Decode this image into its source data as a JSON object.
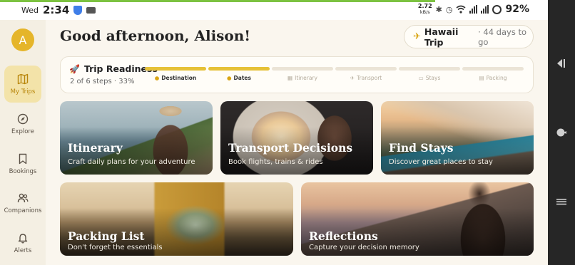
{
  "status_bar": {
    "day": "Wed",
    "time": "2:34",
    "net_speed_value": "2.72",
    "net_speed_unit": "kB/s",
    "battery": "92%"
  },
  "sidebar": {
    "avatar_initial": "A",
    "items": [
      {
        "label": "My Trips",
        "icon": "map-icon",
        "active": true
      },
      {
        "label": "Explore",
        "icon": "compass-icon",
        "active": false
      },
      {
        "label": "Bookings",
        "icon": "bookmark-icon",
        "active": false
      },
      {
        "label": "Companions",
        "icon": "users-icon",
        "active": false
      },
      {
        "label": "Alerts",
        "icon": "bell-icon",
        "active": false
      }
    ]
  },
  "header": {
    "greeting": "Good afternoon, Alison!",
    "trip_name": "Hawaii Trip",
    "trip_countdown": "· 44 days to go"
  },
  "readiness": {
    "title": "Trip Readiness",
    "summary": "2 of 6 steps · 33%",
    "progress_fraction": 0.33,
    "steps": [
      {
        "label": "Destination",
        "done": true
      },
      {
        "label": "Dates",
        "done": true
      },
      {
        "label": "Itinerary",
        "done": false
      },
      {
        "label": "Transport",
        "done": false
      },
      {
        "label": "Stays",
        "done": false
      },
      {
        "label": "Packing",
        "done": false
      }
    ]
  },
  "tiles": [
    {
      "title": "Itinerary",
      "subtitle": "Craft daily plans for your adventure"
    },
    {
      "title": "Transport Decisions",
      "subtitle": "Book flights, trains & rides"
    },
    {
      "title": "Find Stays",
      "subtitle": "Discover great places to stay"
    },
    {
      "title": "Packing List",
      "subtitle": "Don't forget the essentials"
    },
    {
      "title": "Reflections",
      "subtitle": "Capture your decision memory"
    }
  ],
  "colors": {
    "accent": "#e5b52a",
    "background": "#faf6ee",
    "sidebar_active": "#f3e3a9",
    "progress_done": "#e6c137"
  }
}
